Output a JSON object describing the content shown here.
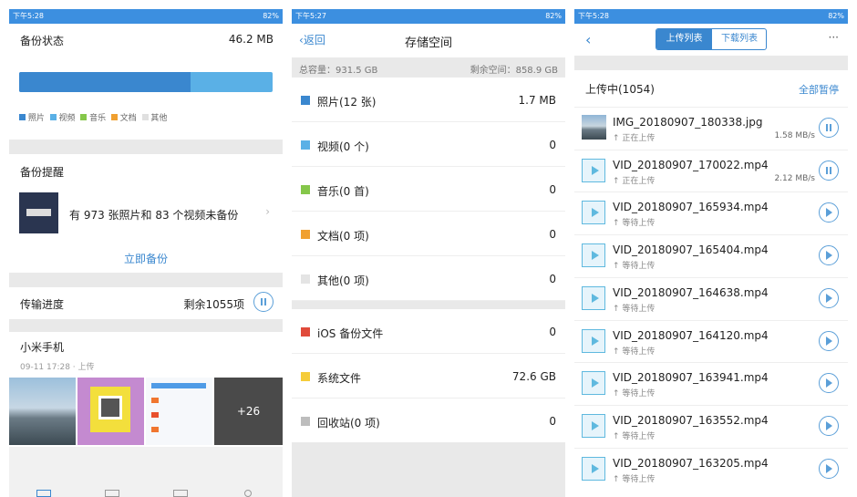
{
  "status_bars": [
    {
      "time": "下午5:28",
      "battery": "82%"
    },
    {
      "time": "下午5:27",
      "battery": "82%"
    },
    {
      "time": "下午5:28",
      "battery": "82%"
    }
  ],
  "backup": {
    "status_label": "备份状态",
    "status_value": "46.2 MB",
    "legend": [
      "照片",
      "视频",
      "音乐",
      "文档",
      "其他"
    ],
    "colors": {
      "photo": "#3a87cf",
      "video": "#5ab0e6",
      "music": "#85c74a",
      "doc": "#f0a030",
      "other": "#e0e0e0"
    },
    "reminder_label": "备份提醒",
    "reminder_text": "有 973 张照片和 83 个视频未备份",
    "backup_now": "立即备份",
    "progress_label": "传输进度",
    "progress_value": "剩余1055项",
    "device": "小米手机",
    "device_time": "09-11 17:28 · 上传",
    "more_count": "+26"
  },
  "storage": {
    "back": "返回",
    "title": "存储空间",
    "total": "总容量：931.5 GB",
    "free": "剩余空间：858.9 GB",
    "items": [
      {
        "label": "照片(12 张)",
        "value": "1.7 MB",
        "color": "#3a87cf"
      },
      {
        "label": "视频(0 个)",
        "value": "0",
        "color": "#5ab0e6"
      },
      {
        "label": "音乐(0 首)",
        "value": "0",
        "color": "#85c74a"
      },
      {
        "label": "文档(0 项)",
        "value": "0",
        "color": "#f0a030"
      },
      {
        "label": "其他(0 项)",
        "value": "0",
        "color": "#e4e4e4"
      }
    ],
    "items2": [
      {
        "label": "iOS 备份文件",
        "value": "0",
        "color": "#e04a3a"
      },
      {
        "label": "系统文件",
        "value": "72.6 GB",
        "color": "#f5cc3a"
      },
      {
        "label": "回收站(0 项)",
        "value": "0",
        "color": "#bdbdbd"
      }
    ]
  },
  "transfer": {
    "tabs": [
      "上传列表",
      "下载列表"
    ],
    "uploading_label": "上传中(1054)",
    "pause_all": "全部暂停",
    "files": [
      {
        "name": "IMG_20180907_180338.jpg",
        "status": "正在上传",
        "speed": "1.58 MB/s"
      },
      {
        "name": "VID_20180907_170022.mp4",
        "status": "正在上传",
        "speed": "2.12 MB/s"
      },
      {
        "name": "VID_20180907_165934.mp4",
        "status": "等待上传",
        "speed": ""
      },
      {
        "name": "VID_20180907_165404.mp4",
        "status": "等待上传",
        "speed": ""
      },
      {
        "name": "VID_20180907_164638.mp4",
        "status": "等待上传",
        "speed": ""
      },
      {
        "name": "VID_20180907_164120.mp4",
        "status": "等待上传",
        "speed": ""
      },
      {
        "name": "VID_20180907_163941.mp4",
        "status": "等待上传",
        "speed": ""
      },
      {
        "name": "VID_20180907_163552.mp4",
        "status": "等待上传",
        "speed": ""
      },
      {
        "name": "VID_20180907_163205.mp4",
        "status": "等待上传",
        "speed": ""
      }
    ]
  }
}
